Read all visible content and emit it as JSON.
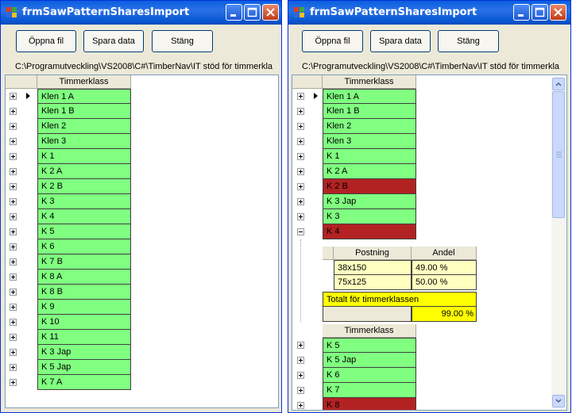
{
  "window_title": "frmSawPatternSharesImport",
  "buttons": {
    "open": "Öppna fil",
    "save": "Spara data",
    "close": "Stäng"
  },
  "file_path": "C:\\Programutveckling\\VS2008\\C#\\TimberNav\\IT stöd för timmerkla",
  "column_header": "Timmerklass",
  "left_rows": [
    "Klen 1 A",
    "Klen 1 B",
    "Klen 2",
    "Klen 3",
    "K 1",
    "K 2 A",
    "K 2 B",
    "K 3",
    "K 4",
    "K 5",
    "K 6",
    "K 7 B",
    "K 8 A",
    "K 8 B",
    "K 9",
    "K 10",
    "K 11",
    "K 3 Jap",
    "K 5 Jap",
    "K 7 A"
  ],
  "right_rows": [
    {
      "label": "Klen 1 A",
      "status": "ok"
    },
    {
      "label": "Klen 1 B",
      "status": "ok"
    },
    {
      "label": "Klen 2",
      "status": "ok"
    },
    {
      "label": "Klen 3",
      "status": "ok"
    },
    {
      "label": "K 1",
      "status": "ok"
    },
    {
      "label": "K 2 A",
      "status": "ok"
    },
    {
      "label": "K 2 B",
      "status": "error"
    },
    {
      "label": "K 3 Jap",
      "status": "ok"
    },
    {
      "label": "K 3",
      "status": "ok"
    },
    {
      "label": "K 4",
      "status": "error"
    }
  ],
  "detail": {
    "col_pattern": "Postning",
    "col_share": "Andel",
    "rows": [
      {
        "pattern": "38x150",
        "share": "49.00 %"
      },
      {
        "pattern": "75x125",
        "share": "50.00 %"
      }
    ],
    "total_label": "Totalt för timmerklassen",
    "total_value": "99.00 %"
  },
  "right_rows2": [
    {
      "label": "K 5",
      "status": "ok"
    },
    {
      "label": "K 5 Jap",
      "status": "ok"
    },
    {
      "label": "K 6",
      "status": "ok"
    },
    {
      "label": "K 7",
      "status": "ok"
    },
    {
      "label": "K 8",
      "status": "error"
    }
  ],
  "colors": {
    "ok": "#80ff80",
    "error": "#b22222",
    "total": "#ffff00",
    "detail": "#ffffc0",
    "titlebar": "#0a5fe0"
  }
}
